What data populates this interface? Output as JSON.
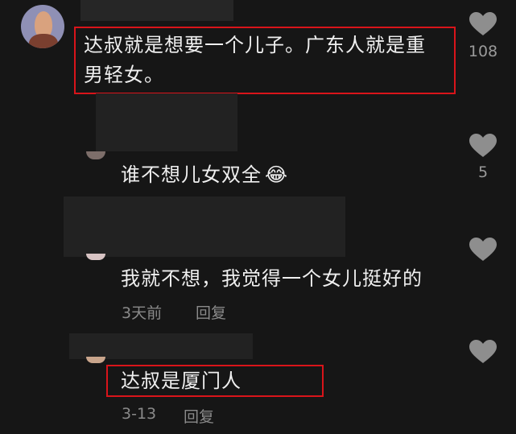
{
  "comments": [
    {
      "text_line1": "达叔就是想要一个儿子。广东人就是重",
      "text_line2": "男轻女。",
      "likes": "108"
    },
    {
      "text": "谁不想儿女双全",
      "emoji": "😂",
      "likes": "5"
    },
    {
      "text": "我就不想，我觉得一个女儿挺好的",
      "time": "3天前",
      "reply_label": "回复"
    },
    {
      "text": "达叔是厦门人",
      "time": "3-13",
      "reply_label": "回复"
    }
  ],
  "colors": {
    "highlight": "#d9141a",
    "background": "#161616"
  },
  "icons": {
    "like": "heart-icon"
  }
}
